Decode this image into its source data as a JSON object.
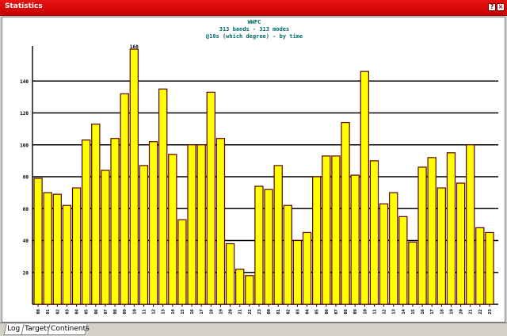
{
  "window": {
    "title": "Statistics",
    "help_glyph": "?",
    "close_glyph": "×"
  },
  "tabs": [
    {
      "label": "Log"
    },
    {
      "label": "Targets"
    },
    {
      "label": "Continents"
    }
  ],
  "colors": {
    "bar_fill": "#ffff00",
    "bar_stroke": "#5a0000",
    "title_text": "#006a6a",
    "titlebar": "#d40000"
  },
  "chart_data": {
    "type": "bar",
    "title": "WWPC",
    "subtitle_lines": [
      "313 bands - 313 modes",
      "@10s (which degree) - by time"
    ],
    "ylim": [
      0,
      160
    ],
    "yticks": [
      20,
      40,
      60,
      80,
      100,
      120,
      140
    ],
    "grid": true,
    "peak_label": "160",
    "categories": [
      "00",
      "01",
      "02",
      "03",
      "04",
      "05",
      "06",
      "07",
      "08",
      "09",
      "10",
      "11",
      "12",
      "13",
      "14",
      "15",
      "16",
      "17",
      "18",
      "19",
      "20",
      "21",
      "22",
      "23",
      "00",
      "01",
      "02",
      "03",
      "04",
      "05",
      "06",
      "07",
      "08",
      "09",
      "10",
      "11",
      "12",
      "13",
      "14",
      "15",
      "16",
      "17",
      "18",
      "19",
      "20",
      "21",
      "22",
      "23"
    ],
    "values": [
      79,
      70,
      69,
      62,
      73,
      103,
      113,
      84,
      104,
      132,
      160,
      87,
      102,
      135,
      94,
      53,
      100,
      100,
      133,
      104,
      38,
      22,
      18,
      74,
      72,
      87,
      62,
      40,
      45,
      80,
      93,
      93,
      114,
      81,
      146,
      90,
      63,
      70,
      55,
      39,
      86,
      92,
      73,
      95,
      76,
      100,
      48,
      45
    ],
    "xlabel": "",
    "ylabel": ""
  }
}
